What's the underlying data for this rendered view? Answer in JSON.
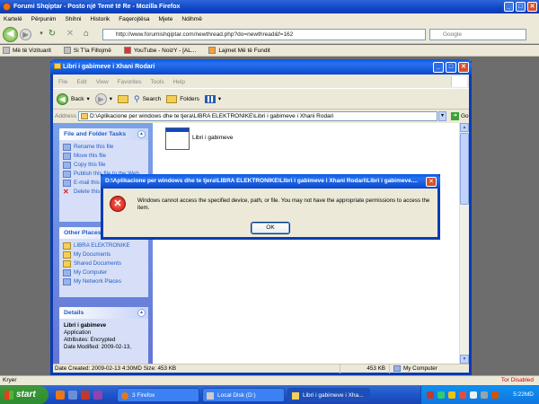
{
  "firefox": {
    "title": "Forumi Shqiptar - Posto një Temë të Re - Mozilla Firefox",
    "menu": [
      "Kartelë",
      "Përpunim",
      "Shihni",
      "Historik",
      "Faqerojtësa",
      "Mjete",
      "Ndihmë"
    ],
    "url": "http://www.forumishqiptar.com/newthread.php?do=newthread&f=162",
    "search_placeholder": "Google",
    "bookmarks": [
      "Më të Vizituarit",
      "Si T'ia Fillojmë",
      "YouTube - NoizY - [AL...",
      "Lajmet Më të Fundit"
    ],
    "status_left": "Kryer",
    "status_right": "Tor Disabled"
  },
  "explorer": {
    "title": "Libri i gabimeve i Xhani Rodari",
    "menu": [
      "File",
      "Edit",
      "View",
      "Favorites",
      "Tools",
      "Help"
    ],
    "toolbar": {
      "back": "Back",
      "search": "Search",
      "folders": "Folders"
    },
    "address_label": "Address",
    "address": "D:\\Aplikacione per windows dhe te tjera\\LIBRA ELEKTRONIKE\\Libri i gabimeve i Xhani Rodari",
    "go_label": "Go",
    "file_tasks": {
      "title": "File and Folder Tasks",
      "items": [
        "Rename this file",
        "Move this file",
        "Copy this file",
        "Publish this file to the Web",
        "E-mail this file",
        "Delete this file"
      ]
    },
    "other_places": {
      "title": "Other Places",
      "items": [
        "LIBRA ELEKTRONIKE",
        "My Documents",
        "Shared Documents",
        "My Computer",
        "My Network Places"
      ]
    },
    "details": {
      "title": "Details",
      "name": "Libri i gabimeve",
      "type": "Application",
      "attributes": "Attributes: Encrypted",
      "modified": "Date Modified: 2009-02-13,"
    },
    "file_name": "Libri i gabimeve",
    "status": {
      "date": "Date Created: 2009-02-13 4:30MD Size: 453 KB",
      "size": "453 KB",
      "location": "My Computer"
    }
  },
  "dialog": {
    "title": "D:\\Aplikacione per windows dhe te tjera\\LIBRA ELEKTRONIKE\\Libri i gabimeve i Xhani Rodari\\Libri i gabimeve....",
    "message": "Windows cannot access the specified device, path, or file.  You may not have the appropriate permissions to access the item.",
    "ok_label": "OK"
  },
  "taskbar": {
    "start_label": "start",
    "tasks": [
      "3 Firefox",
      "Local Disk (D:)",
      "Libri i gabimeve i Xha..."
    ],
    "clock": "5:22MD"
  }
}
